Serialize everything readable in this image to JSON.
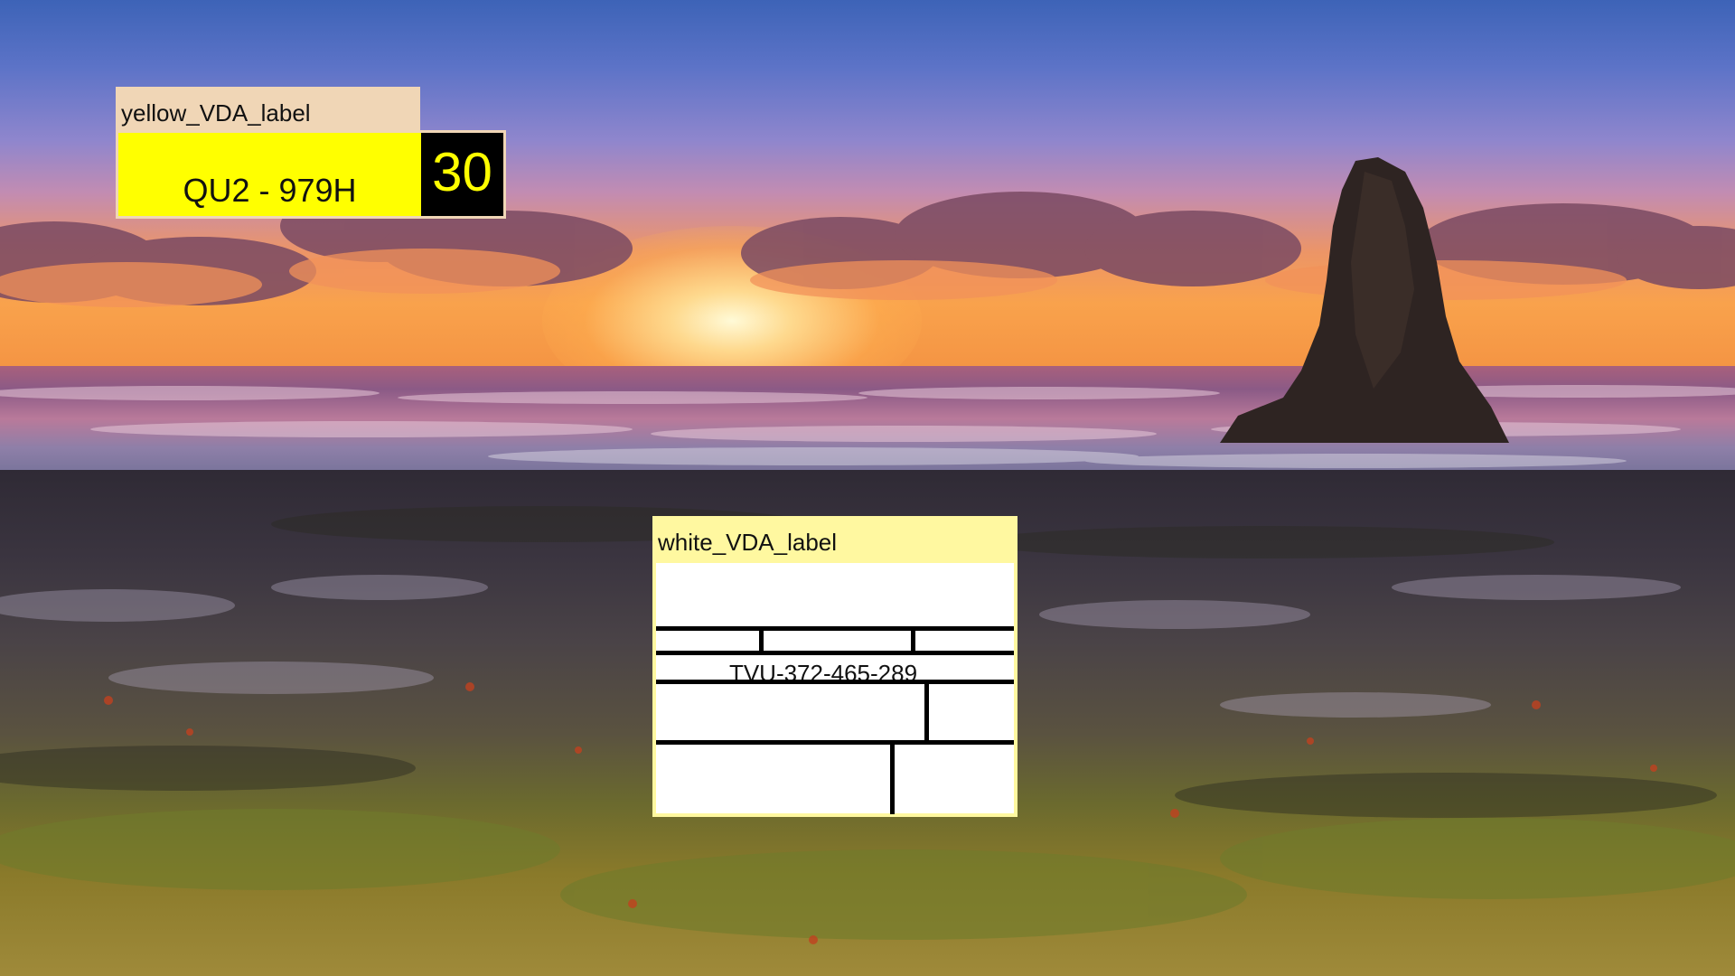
{
  "wallpaper": {
    "description_icon": "seascape-sunset-wallpaper"
  },
  "yellow_widget": {
    "title": "yellow_VDA_label",
    "plate_text": "QU2 - 979H",
    "number": "30",
    "plate_color": "#ffff00",
    "title_bar_color": "#f0d6b6"
  },
  "white_widget": {
    "title": "white_VDA_label",
    "plate_text": "TVU-372-465-289",
    "plate_color": "#ffffff",
    "title_bar_color": "#fff8a0"
  }
}
